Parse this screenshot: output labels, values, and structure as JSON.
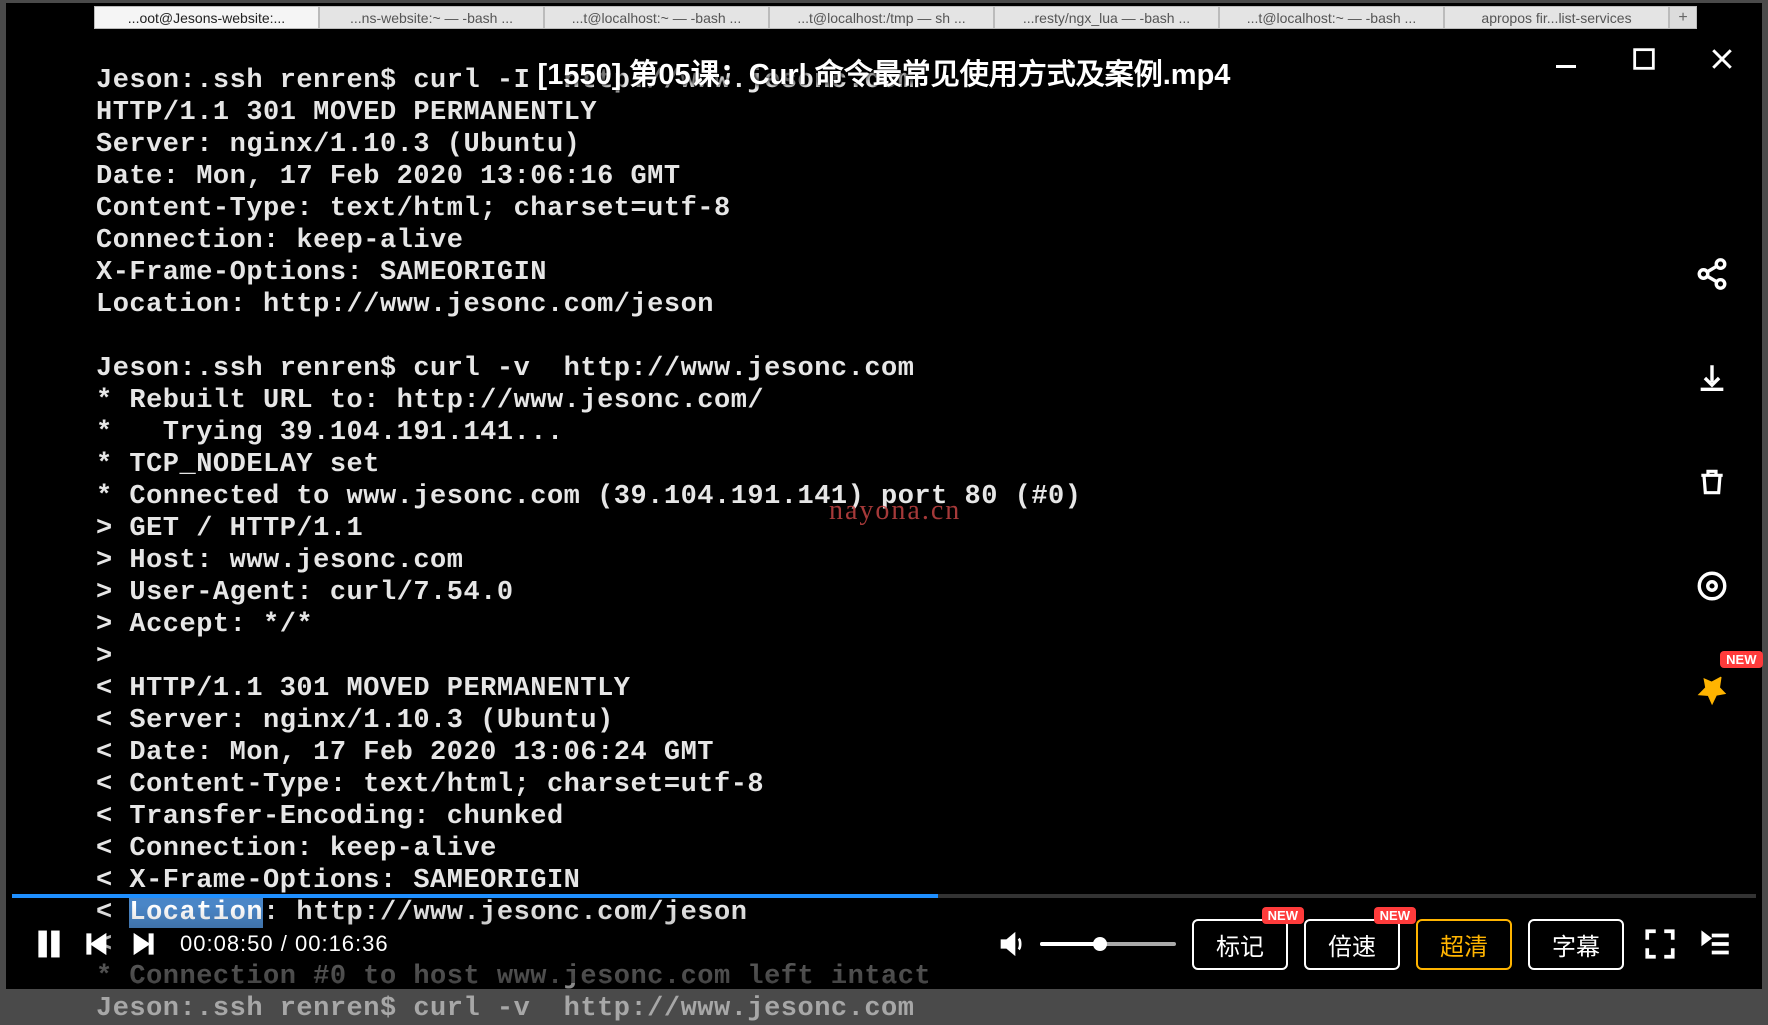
{
  "tabs": {
    "items": [
      "...oot@Jesons-website:...",
      "...ns-website:~ — -bash ...",
      "...t@localhost:~ — -bash ...",
      "...t@localhost:/tmp — sh ...",
      "...resty/ngx_lua — -bash ...",
      "...t@localhost:~ — -bash ...",
      "apropos fir...list-services"
    ],
    "add": "+"
  },
  "title": "[1550] 第05课：Curl 命令最常见使用方式及案例.mp4",
  "watermark": "nayona.cn",
  "terminal": {
    "line01": "Jeson:.ssh renren$ curl -I  http://www.jesonc.com",
    "line02": "HTTP/1.1 301 MOVED PERMANENTLY",
    "line03": "Server: nginx/1.10.3 (Ubuntu)",
    "line04": "Date: Mon, 17 Feb 2020 13:06:16 GMT",
    "line05": "Content-Type: text/html; charset=utf-8",
    "line06": "Connection: keep-alive",
    "line07": "X-Frame-Options: SAMEORIGIN",
    "line08": "Location: http://www.jesonc.com/jeson",
    "line09": "",
    "line10": "Jeson:.ssh renren$ curl -v  http://www.jesonc.com",
    "line11": "* Rebuilt URL to: http://www.jesonc.com/",
    "line12": "*   Trying 39.104.191.141...",
    "line13": "* TCP_NODELAY set",
    "line14": "* Connected to www.jesonc.com (39.104.191.141) port 80 (#0)",
    "line15": "> GET / HTTP/1.1",
    "line16": "> Host: www.jesonc.com",
    "line17": "> User-Agent: curl/7.54.0",
    "line18": "> Accept: */*",
    "line19": ">",
    "line20": "< HTTP/1.1 301 MOVED PERMANENTLY",
    "line21": "< Server: nginx/1.10.3 (Ubuntu)",
    "line22": "< Date: Mon, 17 Feb 2020 13:06:24 GMT",
    "line23": "< Content-Type: text/html; charset=utf-8",
    "line24": "< Transfer-Encoding: chunked",
    "line25": "< Connection: keep-alive",
    "line26": "< X-Frame-Options: SAMEORIGIN",
    "line27a": "< ",
    "line27hl": "Location",
    "line27b": ": http://www.jesonc.com/jeson",
    "line28": "<",
    "line29": "* Connection #0 to host www.jesonc.com left intact",
    "line30": "Jeson:.ssh renren$ curl -v  http://www.jesonc.com"
  },
  "time": {
    "current": "00:08:50",
    "sep": " / ",
    "total": "00:16:36"
  },
  "buttons": {
    "mark": "标记",
    "speed": "倍速",
    "quality": "超清",
    "subtitle": "字幕",
    "new": "NEW"
  },
  "progress_pct": 53.1,
  "volume_pct": 44
}
